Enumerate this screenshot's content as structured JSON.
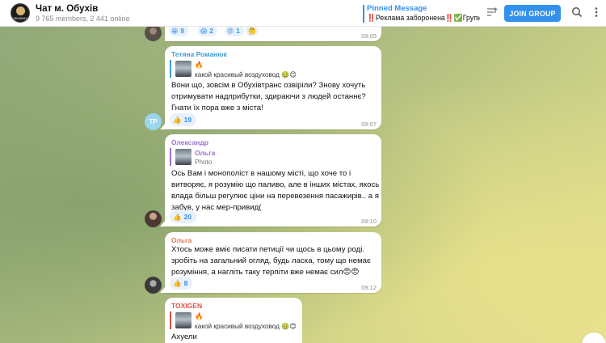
{
  "header": {
    "chat_title": "Чат м. Обухів",
    "chat_subtitle": "9 765 members, 2 441 online",
    "avatar_text": "OBUKHIV",
    "pinned_title": "Pinned Message",
    "pinned_text": "‼️Реклама заборонена‼️✅Групи...",
    "join_label": "JOIN GROUP"
  },
  "top_message": {
    "reactions": [
      {
        "emoji": "😁",
        "count": "9"
      },
      {
        "emoji": "😱",
        "count": "2"
      },
      {
        "emoji": "😡",
        "count": "1"
      },
      {
        "emoji": "🤔",
        "count": ""
      }
    ],
    "time": "09:05"
  },
  "messages": [
    {
      "sender": "Тетяна Романюк",
      "sender_color": "#3c9bd6",
      "avatar_initials": "TP",
      "reply_name": "🔥",
      "reply_text": "какой красивый воздуховод 🤢😊",
      "text": "Вони що, зовсім в Обухівтранс озвіріли? Знову хочуть отримувати надприбутки, здираючи з людей останнє? Гнати їх пора вже з міста!",
      "reaction_emoji": "👍",
      "reaction_count": "19",
      "time": "09:07"
    },
    {
      "sender": "Олександр",
      "sender_color": "#a070d0",
      "reply_name": "Ольга",
      "reply_text": "Photo",
      "text": "Ось Вам і монополіст в нашому місті, що хоче то і витворяє, я розумію що паливо, але в інших містах, якось влада більш регулює ціни на перевезення пасажирів.. а я забув, у нас мер-привид(",
      "reaction_emoji": "👍",
      "reaction_count": "20",
      "time": "09:10"
    },
    {
      "sender": "Ольга",
      "sender_color": "#e07a50",
      "text": "Хтось може вміє писати петиції чи щось в цьому роді. зробіть на загальний огляд, будь ласка, тому що немає розуміння, а нагліть таку терпіти вже немає сил😠😠",
      "reaction_emoji": "👍",
      "reaction_count": "8",
      "time": "09:12"
    },
    {
      "sender": "TOXIGEN",
      "sender_color": "#e0504a",
      "reply_name": "🔥",
      "reply_text": "какой красивый воздуховод 🤢😊",
      "text": "Ахуели"
    }
  ]
}
